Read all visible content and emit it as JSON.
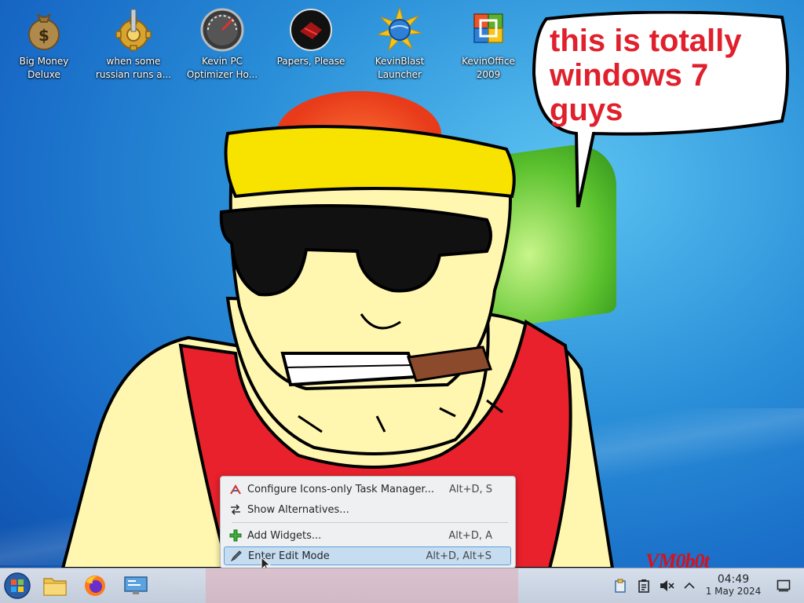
{
  "desktop": {
    "icons": [
      {
        "label": "Big Money\nDeluxe",
        "icon": "money-bag-icon"
      },
      {
        "label": "when some\nrussian runs a...",
        "icon": "gear-icon"
      },
      {
        "label": "Kevin PC\nOptimizer Ho...",
        "icon": "speedometer-icon"
      },
      {
        "label": "Papers, Please",
        "icon": "papers-please-icon"
      },
      {
        "label": "KevinBlast\nLauncher",
        "icon": "globe-burst-icon"
      },
      {
        "label": "KevinOffice\n2009",
        "icon": "office-logo-icon"
      }
    ],
    "speech_bubble": "this is totally windows 7 guys",
    "signature": "VM0b0t"
  },
  "context_menu": {
    "items": [
      {
        "label": "Configure Icons-only Task Manager...",
        "shortcut": "Alt+D, S",
        "icon": "configure-icon"
      },
      {
        "label": "Show Alternatives...",
        "shortcut": "",
        "icon": "alternatives-icon"
      },
      {
        "label": "Add Widgets...",
        "shortcut": "Alt+D, A",
        "icon": "add-widgets-icon"
      },
      {
        "label": "Enter Edit Mode",
        "shortcut": "Alt+D, Alt+S",
        "icon": "edit-mode-icon"
      }
    ]
  },
  "taskbar": {
    "pinned": [
      "start-orb-icon",
      "file-manager-icon",
      "firefox-icon",
      "system-settings-icon"
    ],
    "tray": [
      "clipboard-icon",
      "notes-icon",
      "volume-muted-icon",
      "chevron-up-icon"
    ],
    "clock_time": "04:49",
    "clock_date": "1 May 2024"
  },
  "colors": {
    "bubble_text": "#e0202c",
    "menu_highlight": "#c6dcf0",
    "taskbar": "#dfe2e8"
  }
}
